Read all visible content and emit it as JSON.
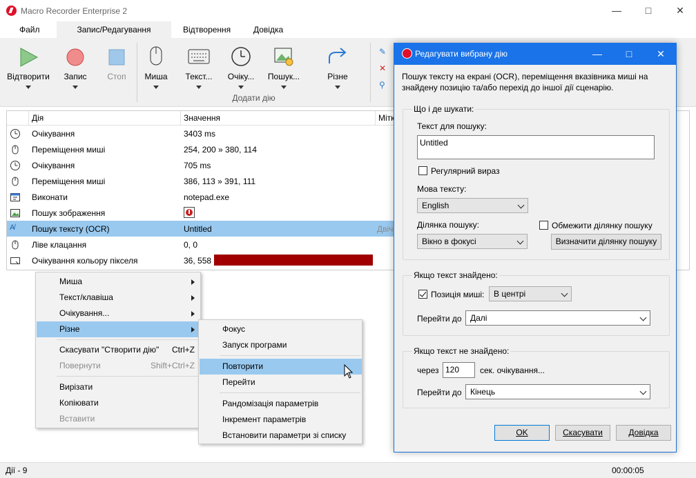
{
  "app": {
    "title": "Macro Recorder Enterprise 2"
  },
  "menu": {
    "file": "Файл",
    "edit": "Запис/Редагування",
    "playback": "Відтворення",
    "help": "Довідка"
  },
  "ribbon": {
    "play": "Відтворити",
    "record": "Запис",
    "stop": "Стоп",
    "mouse": "Миша",
    "text": "Текст...",
    "wait": "Очіку...",
    "search": "Пошук...",
    "misc": "Різне",
    "group_label": "Додати дію"
  },
  "grid": {
    "headers": [
      "Дія",
      "Значення",
      "Мітк"
    ],
    "rows": [
      {
        "action": "Очікування",
        "value": "3403 ms",
        "icon": "clock-icon"
      },
      {
        "action": "Переміщення миші",
        "value": "254, 200 » 380, 114",
        "icon": "mouse-icon"
      },
      {
        "action": "Очікування",
        "value": "705 ms",
        "icon": "clock-icon"
      },
      {
        "action": "Переміщення миші",
        "value": "386, 113 » 391, 111",
        "icon": "mouse-icon"
      },
      {
        "action": "Виконати",
        "value": "notepad.exe",
        "icon": "run-icon"
      },
      {
        "action": "Пошук зображення",
        "value": "",
        "icon": "image-icon"
      },
      {
        "action": "Пошук тексту (OCR)",
        "value": "Untitled",
        "label": "Двіч",
        "icon": "ocr-icon"
      },
      {
        "action": "Ліве клацання",
        "value": "0, 0",
        "icon": "mouse-icon"
      },
      {
        "action": "Очікування кольору пікселя",
        "value": "36, 558",
        "icon": "pixel-icon",
        "color": "#a00000"
      }
    ]
  },
  "context_menu": {
    "items": [
      "Миша",
      "Текст/клавіша",
      "Очікування...",
      "Різне"
    ],
    "undo": "Скасувати \"Створити дію\"",
    "undo_sc": "Ctrl+Z",
    "redo": "Повернути",
    "redo_sc": "Shift+Ctrl+Z",
    "cut": "Вирізати",
    "copy": "Копіювати",
    "paste": "Вставити"
  },
  "submenu": {
    "focus": "Фокус",
    "launch": "Запуск програми",
    "repeat": "Повторити",
    "goto": "Перейти",
    "randomize": "Рандомізація параметрів",
    "increment": "Інкремент параметрів",
    "setlist": "Встановити параметри зі списку"
  },
  "status": {
    "actions": "Дії - 9",
    "time": "00:00:05"
  },
  "dialog": {
    "title": "Редагувати вибрану дію",
    "description": "Пошук тексту на екрані (OCR), переміщення вказівника миші на знайдену позицію та/або перехід до іншої дії сценарію.",
    "what_group": "Що і де шукати:",
    "search_text_label": "Текст для пошуку:",
    "search_text": "Untitled",
    "regex": "Регулярний вираз",
    "lang_label": "Мова тексту:",
    "lang": "English",
    "area_label": "Ділянка пошуку:",
    "area": "Вікно в фокусі",
    "limit": "Обмежити ділянку пошуку",
    "define": "Визначити ділянку пошуку",
    "found_group": "Якщо текст знайдено:",
    "mouse_pos": "Позиція миші:",
    "mouse_pos_val": "В центрі",
    "goto_label": "Перейти до",
    "goto_found": "Далі",
    "notfound_group": "Якщо текст не знайдено:",
    "after": "через",
    "seconds": "120",
    "wait_suffix": "сек. очікування...",
    "goto_notfound": "Кінець",
    "ok": "OK",
    "cancel": "Скасувати",
    "help": "Довідка"
  }
}
